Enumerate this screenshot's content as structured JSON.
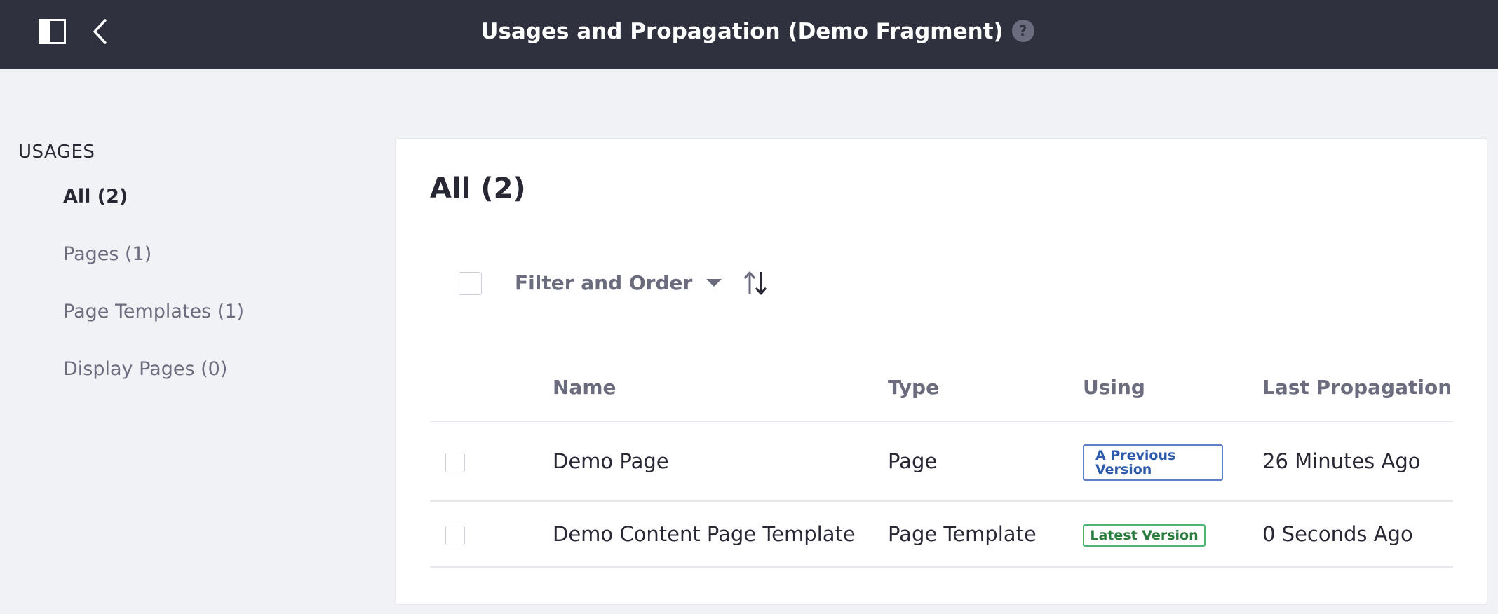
{
  "header": {
    "title": "Usages and Propagation (Demo Fragment)",
    "help_glyph": "?",
    "icons": [
      "sidebar-toggle-icon",
      "back-chevron-icon",
      "help-icon"
    ]
  },
  "sidebar": {
    "heading": "USAGES",
    "items": [
      {
        "label": "All (2)",
        "active": true
      },
      {
        "label": "Pages (1)",
        "active": false
      },
      {
        "label": "Page Templates (1)",
        "active": false
      },
      {
        "label": "Display Pages (0)",
        "active": false
      }
    ]
  },
  "main": {
    "title": "All (2)",
    "toolbar": {
      "filter_label": "Filter and Order",
      "sort_icon": "sort-arrows-icon",
      "filter_icon": "caret-down-icon"
    },
    "table": {
      "columns": [
        "Name",
        "Type",
        "Using",
        "Last Propagation"
      ],
      "rows": [
        {
          "name": "Demo Page",
          "type": "Page",
          "using": "A Previous Version",
          "last_propagation": "26 Minutes Ago"
        },
        {
          "name": "Demo Content Page Template",
          "type": "Page Template",
          "using": "Latest Version",
          "last_propagation": "0 Seconds Ago"
        }
      ]
    }
  },
  "colors": {
    "topbar": "#2f323e",
    "page_bg": "#f1f2f5",
    "text_primary": "#272833",
    "text_secondary": "#6b6c7e",
    "badge_info": "#2e5aac",
    "badge_success": "#287d3c"
  }
}
